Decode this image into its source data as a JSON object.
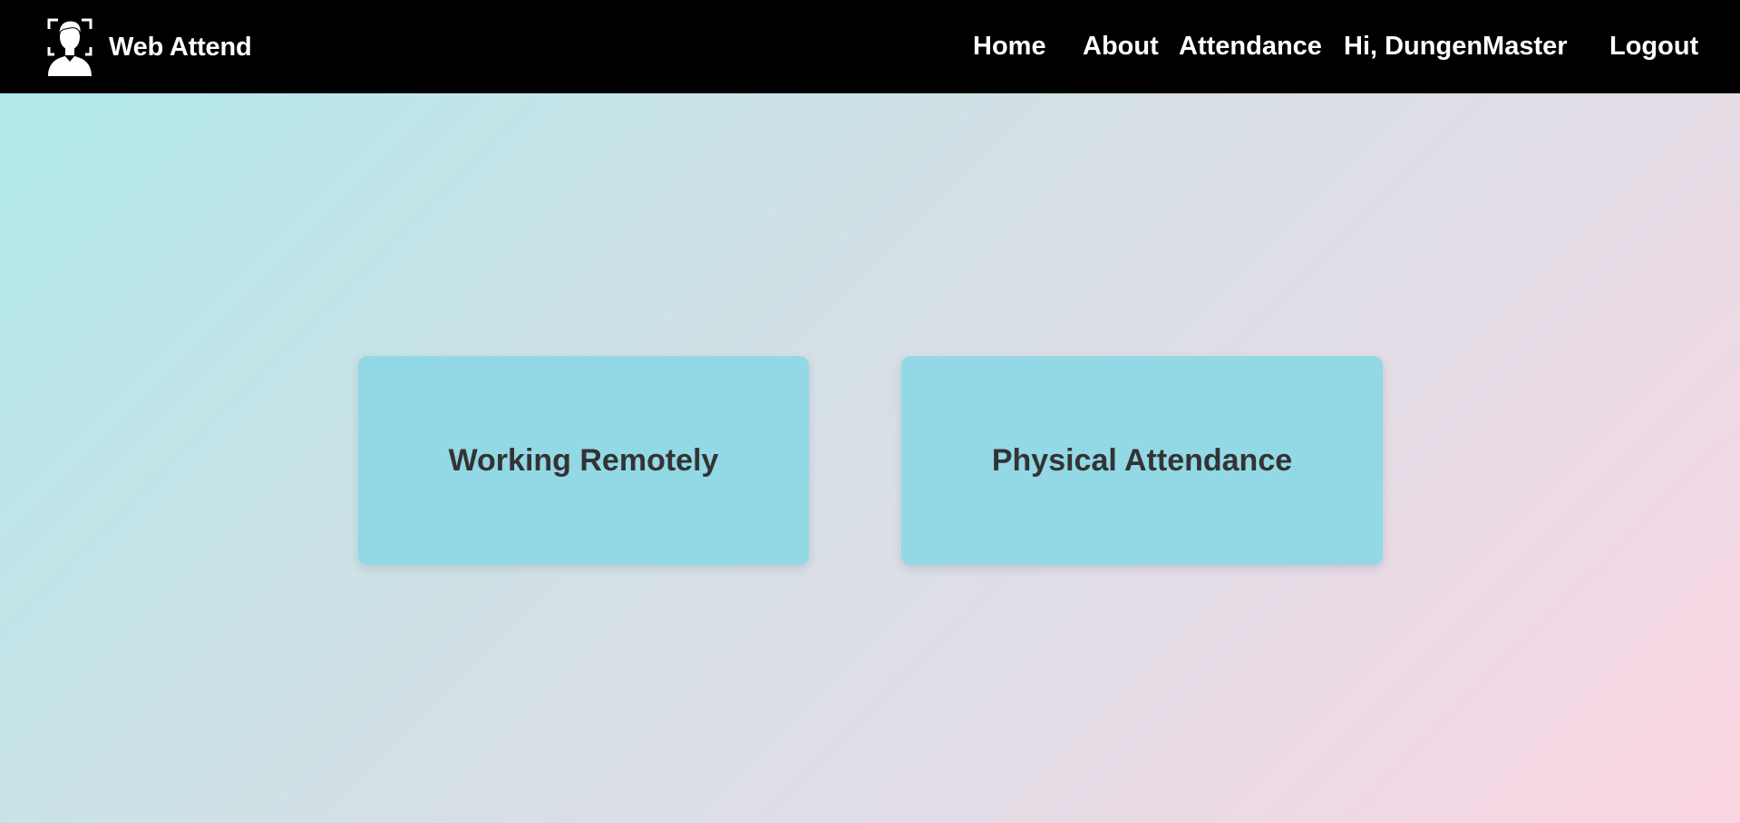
{
  "navbar": {
    "brand": {
      "name": "Web Attend",
      "icon": "face-scan-user-icon"
    },
    "links": {
      "home": "Home",
      "about": "About",
      "attendance": "Attendance",
      "greeting": "Hi, DungenMaster",
      "logout": "Logout"
    }
  },
  "options": {
    "remote": "Working Remotely",
    "physical": "Physical Attendance"
  },
  "colors": {
    "navbar_bg": "#000000",
    "navbar_text": "#ffffff",
    "card_bg": "#92d8e5",
    "card_text": "#333333",
    "gradient_start": "#aeeaea",
    "gradient_end": "#fbd5e2"
  }
}
